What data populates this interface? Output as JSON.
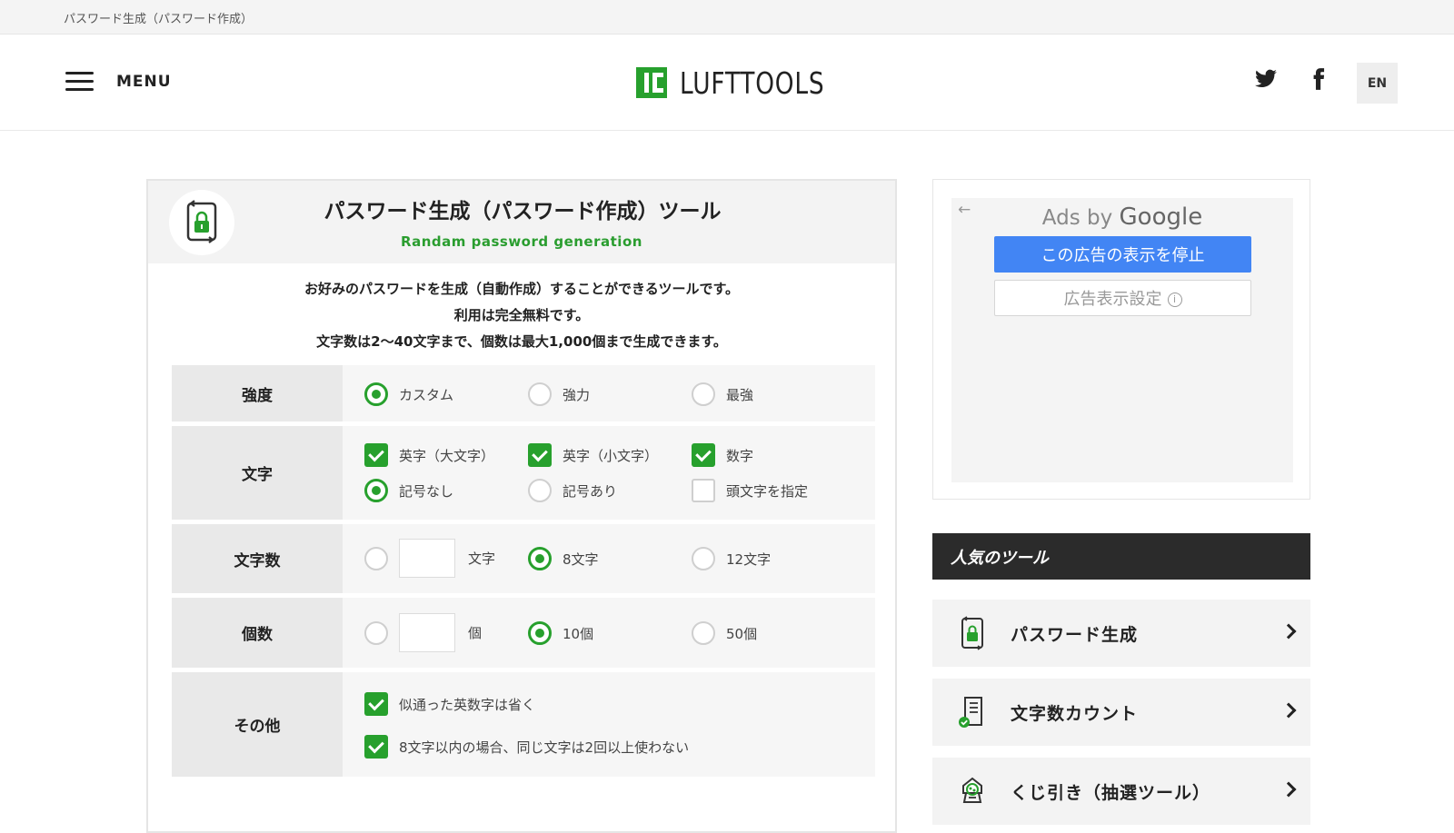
{
  "breadcrumb": "パスワード生成（パスワード作成）",
  "header": {
    "menu_label": "MENU",
    "logo_text": "LUFTTOOLS",
    "lang_button": "EN"
  },
  "tool": {
    "title": "パスワード生成（パスワード作成）ツール",
    "subtitle": "Randam password generation",
    "description": [
      "お好みのパスワードを生成（自動作成）することができるツールです。",
      "利用は完全無料です。",
      "文字数は2〜40文字まで、個数は最大1,000個まで生成できます。"
    ],
    "rows": {
      "strength": {
        "label": "強度",
        "options": [
          {
            "label": "カスタム",
            "selected": true
          },
          {
            "label": "強力",
            "selected": false
          },
          {
            "label": "最強",
            "selected": false
          }
        ]
      },
      "chars": {
        "label": "文字",
        "options": [
          {
            "label": "英字（大文字）",
            "checked": true
          },
          {
            "label": "英字（小文字）",
            "checked": true
          },
          {
            "label": "数字",
            "checked": true
          },
          {
            "label": "記号なし",
            "selected": true
          },
          {
            "label": "記号あり",
            "selected": false
          },
          {
            "label": "頭文字を指定",
            "checked": false
          }
        ]
      },
      "length": {
        "label": "文字数",
        "custom_value": "",
        "custom_unit": "文字",
        "options": [
          {
            "label": "8文字",
            "selected": true
          },
          {
            "label": "12文字",
            "selected": false
          }
        ]
      },
      "count": {
        "label": "個数",
        "custom_value": "",
        "custom_unit": "個",
        "options": [
          {
            "label": "10個",
            "selected": true
          },
          {
            "label": "50個",
            "selected": false
          }
        ]
      },
      "other": {
        "label": "その他",
        "options": [
          {
            "label": "似通った英数字は省く",
            "checked": true
          },
          {
            "label": "8文字以内の場合、同じ文字は2回以上使わない",
            "checked": true
          }
        ]
      }
    }
  },
  "ad": {
    "back_arrow": "←",
    "ads_by": "Ads by",
    "google": "Google",
    "stop_button": "この広告の表示を停止",
    "settings_button": "広告表示設定",
    "info_glyph": "i"
  },
  "popular": {
    "heading": "人気のツール",
    "items": [
      {
        "label": "パスワード生成",
        "icon": "lock-icon"
      },
      {
        "label": "文字数カウント",
        "icon": "document-check-icon"
      },
      {
        "label": "くじ引き（抽選ツール）",
        "icon": "lottery-machine-icon"
      }
    ]
  },
  "colors": {
    "accent_green": "#27a02d",
    "ad_blue": "#4285f4",
    "dark_heading": "#2b2b2b"
  }
}
